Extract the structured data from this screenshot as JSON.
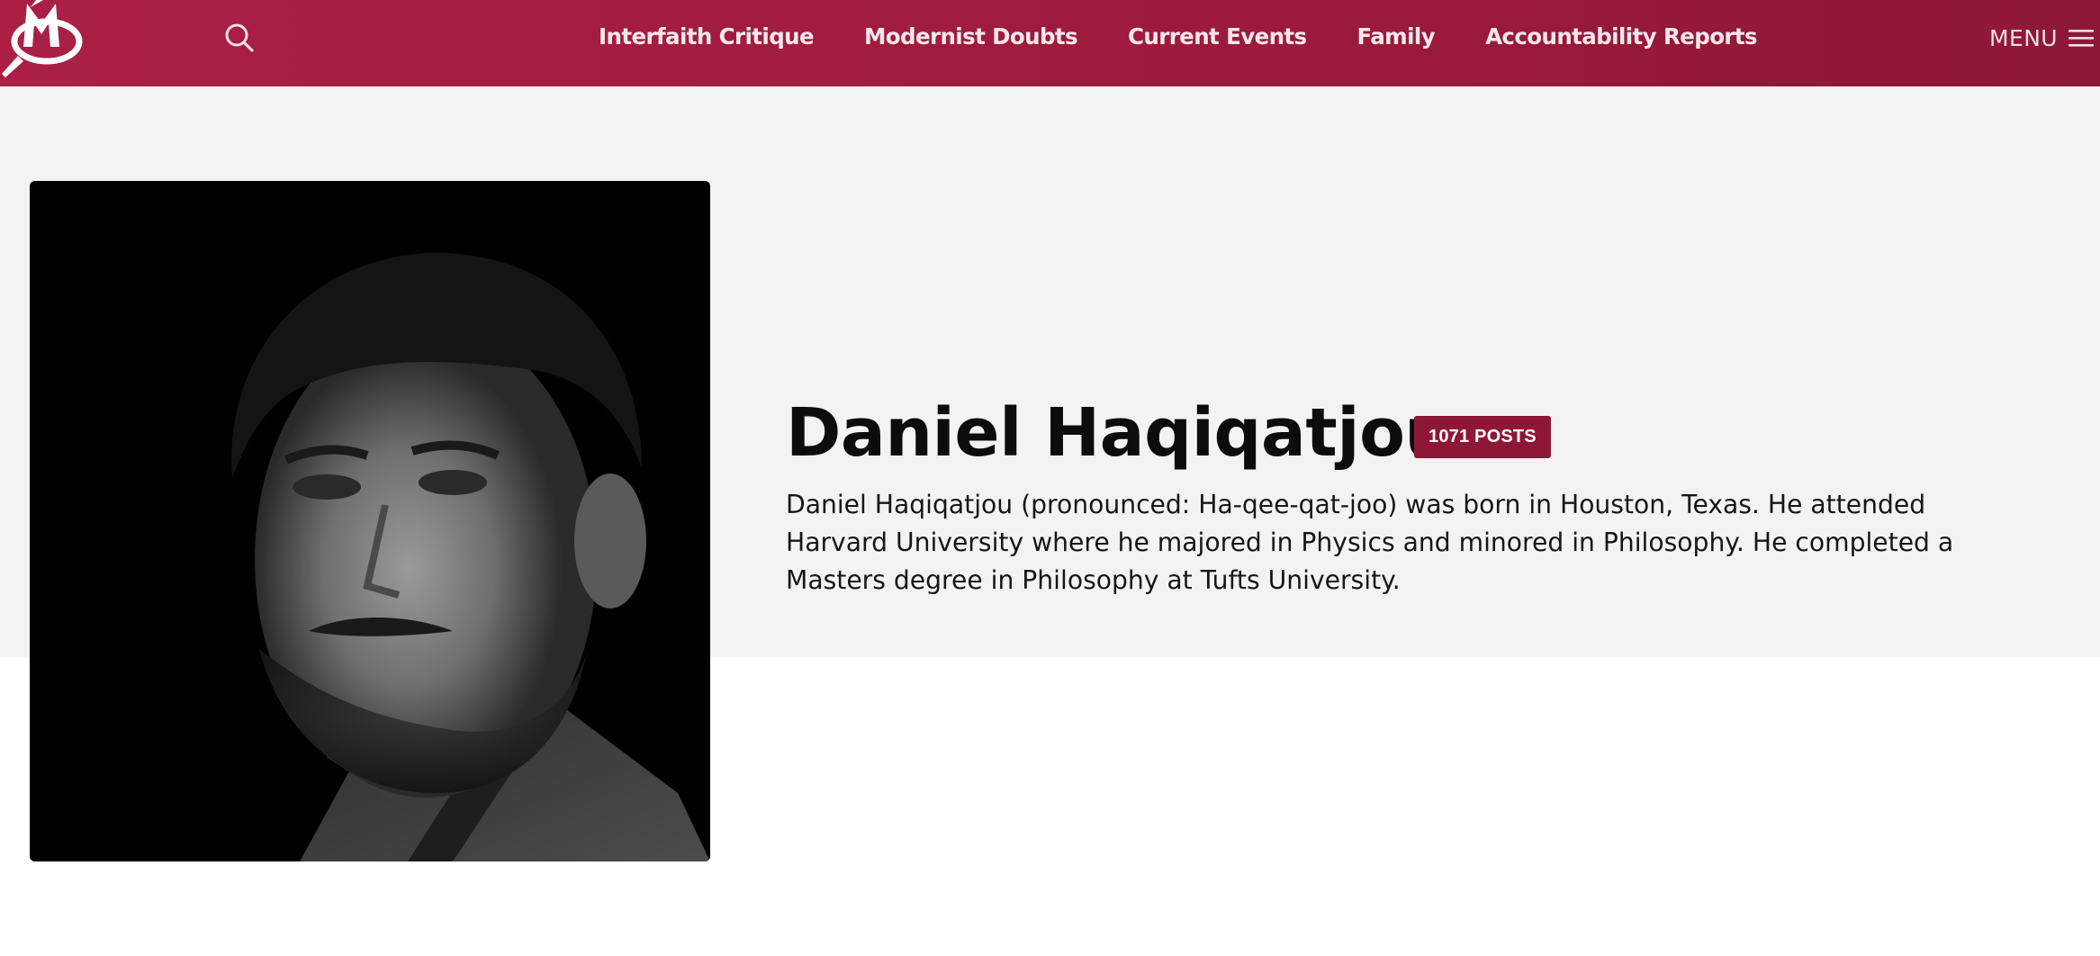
{
  "colors": {
    "brand": "#a11d42",
    "badge": "#8e1737",
    "hero_background": "#f3f3f3"
  },
  "header": {
    "logo_icon": "site-logo-magnifier-icon",
    "search_icon": "search-icon",
    "nav_items": [
      {
        "label": "Interfaith Critique"
      },
      {
        "label": "Modernist Doubts"
      },
      {
        "label": "Current Events"
      },
      {
        "label": "Family"
      },
      {
        "label": "Accountability Reports"
      }
    ],
    "menu_label": "MENU",
    "menu_icon": "hamburger-icon"
  },
  "author": {
    "name": "Daniel Haqiqatjou",
    "posts_badge": "1071 POSTS",
    "bio": "Daniel Haqiqatjou (pronounced: Ha-qee-qat-joo) was born in Houston, Texas. He attended Harvard University where he majored in Physics and minored in Philosophy. He completed a Masters degree in Philosophy at Tufts University."
  }
}
